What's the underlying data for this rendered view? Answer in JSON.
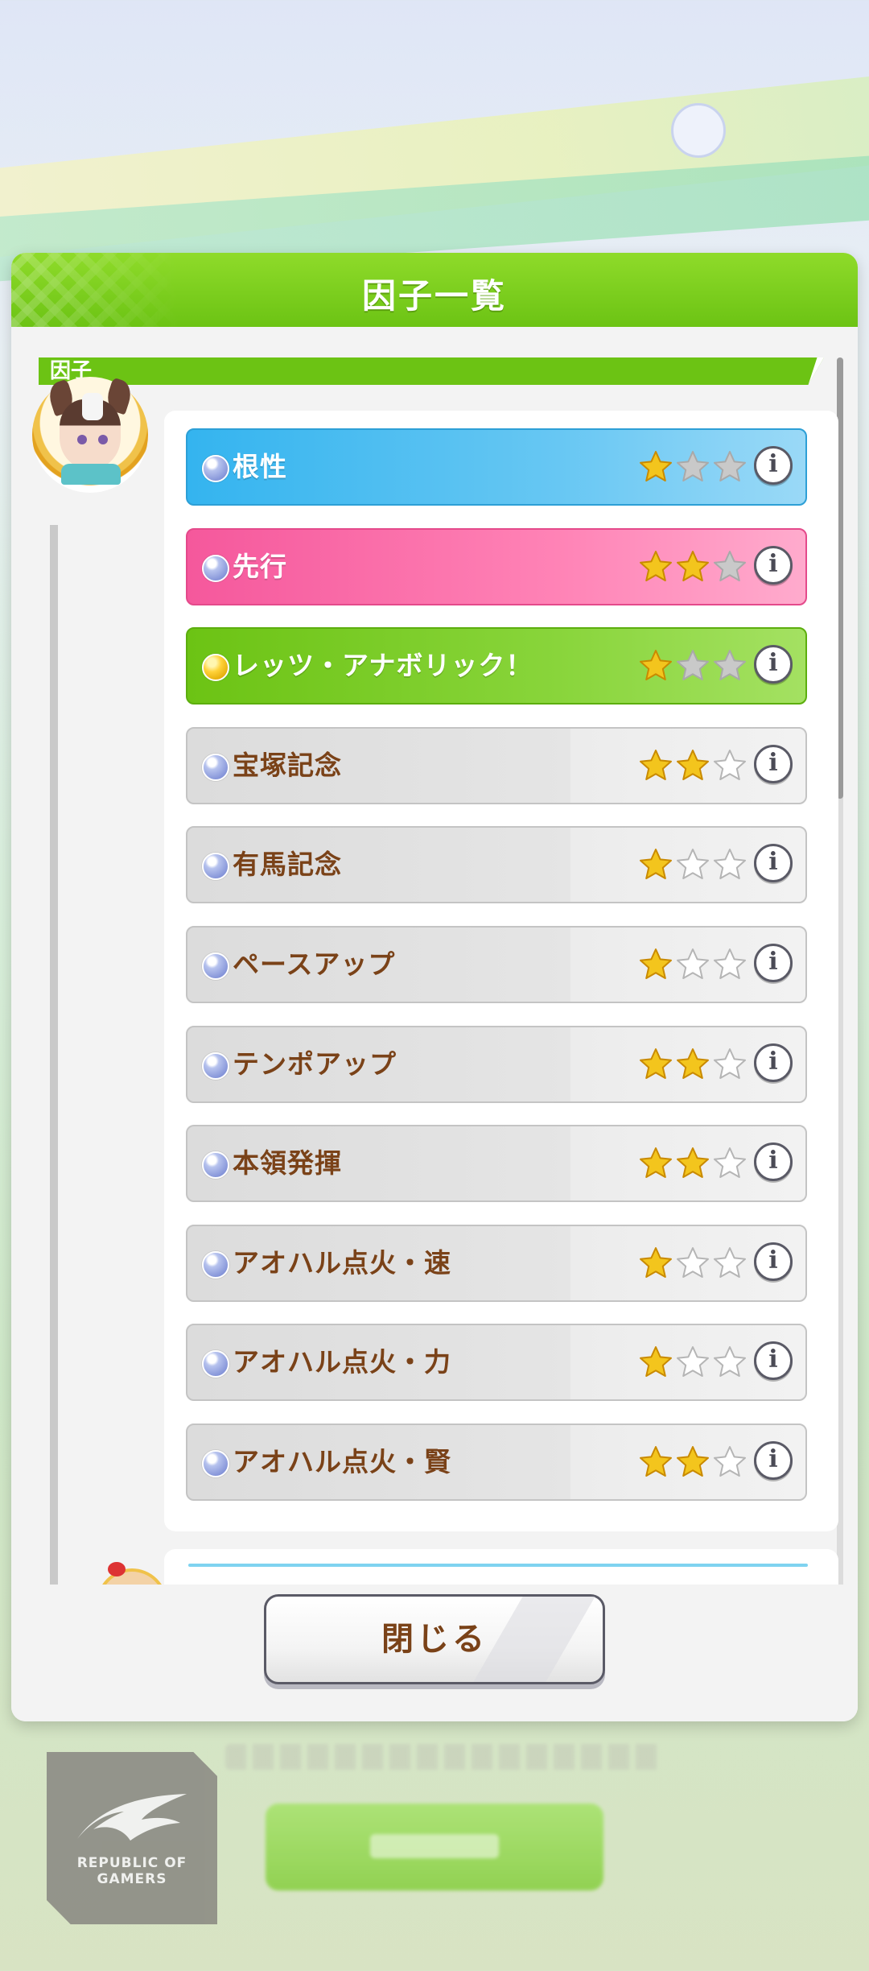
{
  "dialog": {
    "title": "因子一覧",
    "section_label": "因子",
    "close_label": "閉じる"
  },
  "factors": [
    {
      "name": "根性",
      "color": "blue",
      "stars": 1,
      "orb": "silver"
    },
    {
      "name": "先行",
      "color": "pink",
      "stars": 2,
      "orb": "silver"
    },
    {
      "name": "レッツ・アナボリック！",
      "color": "green",
      "stars": 1,
      "orb": "gold"
    },
    {
      "name": "宝塚記念",
      "color": "gray",
      "stars": 2,
      "orb": "silver"
    },
    {
      "name": "有馬記念",
      "color": "gray",
      "stars": 1,
      "orb": "silver"
    },
    {
      "name": "ペースアップ",
      "color": "gray",
      "stars": 1,
      "orb": "silver"
    },
    {
      "name": "テンポアップ",
      "color": "gray",
      "stars": 2,
      "orb": "silver"
    },
    {
      "name": "本領発揮",
      "color": "gray",
      "stars": 2,
      "orb": "silver"
    },
    {
      "name": "アオハル点火・速",
      "color": "gray",
      "stars": 1,
      "orb": "silver"
    },
    {
      "name": "アオハル点火・力",
      "color": "gray",
      "stars": 1,
      "orb": "silver"
    },
    {
      "name": "アオハル点火・賢",
      "color": "gray",
      "stars": 2,
      "orb": "silver"
    }
  ],
  "max_stars": 3,
  "watermark": {
    "text_line1": "REPUBLIC OF",
    "text_line2": "GAMERS"
  },
  "colors": {
    "header_green": "#6cc314",
    "blue_factor": "#34b4ef",
    "pink_factor": "#f5589c",
    "green_factor": "#6cc314",
    "text_brown": "#7a4218",
    "star_gold": "#f3c51d"
  }
}
